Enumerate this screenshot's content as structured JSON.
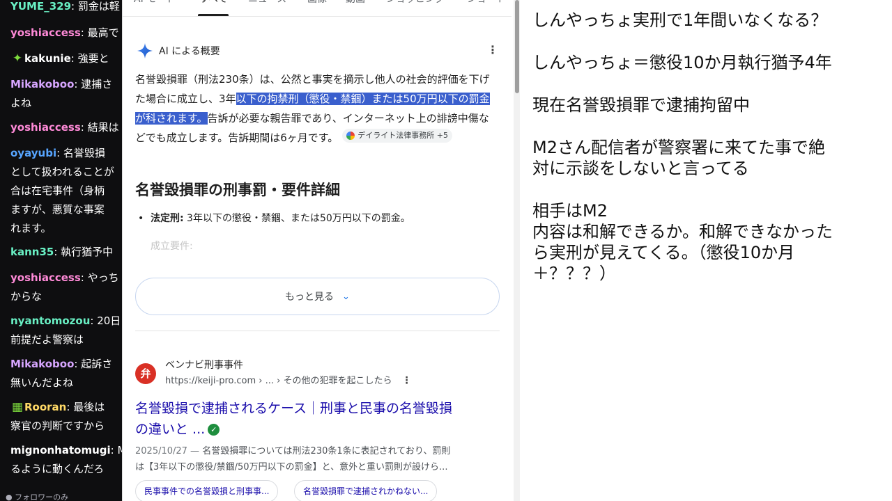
{
  "chat": {
    "messages": [
      {
        "user": "YUME_329",
        "color": "#69f0c4",
        "badge": "",
        "lines": [
          "罰金は軽"
        ]
      },
      {
        "user": "yoshiaccess",
        "color": "#ff8ad8",
        "badge": "",
        "lines": [
          "最高で"
        ]
      },
      {
        "user": "kakunie",
        "color": "#ffffff",
        "badge": "✦",
        "badge_color": "#7ddb3d",
        "lines": [
          "強要と"
        ]
      },
      {
        "user": "Mikakoboo",
        "color": "#d7a6ff",
        "badge": "",
        "lines": [
          "逮捕さ",
          "よね"
        ]
      },
      {
        "user": "yoshiaccess",
        "color": "#ff8ad8",
        "badge": "",
        "lines": [
          "結果は"
        ]
      },
      {
        "user": "oyayubi",
        "color": "#57a5ff",
        "badge": "",
        "lines": [
          "名誉毀損",
          "として扱われることが",
          "合は在宅事件（身柄",
          "ますが、悪質な事案",
          "れます。"
        ]
      },
      {
        "user": "kann35",
        "color": "#69f0c4",
        "badge": "",
        "lines": [
          "執行猶予中"
        ]
      },
      {
        "user": "yoshiaccess",
        "color": "#ff8ad8",
        "badge": "",
        "lines": [
          "やっち",
          "からな"
        ]
      },
      {
        "user": "nyantomozou",
        "color": "#69f0c4",
        "badge": "",
        "lines": [
          "20日",
          "前提だよ警察は"
        ]
      },
      {
        "user": "Mikakoboo",
        "color": "#d7a6ff",
        "badge": "",
        "lines": [
          "起訴さ",
          "無いんだよね"
        ]
      },
      {
        "user": "Rooran",
        "color": "#ffd966",
        "badge": "▦",
        "badge_color": "#7ddb3d",
        "lines": [
          "最後は",
          "察官の判断ですから"
        ]
      },
      {
        "user": "mignonhatomugi",
        "color": "#ffffff",
        "badge": "",
        "lines": [
          "M",
          "るように動くんだろ"
        ]
      }
    ],
    "footer": "● フォロワーのみ"
  },
  "search": {
    "tabs": [
      "AI モード",
      "すべて",
      "ニュース",
      "画像",
      "動画",
      "ショッピング",
      "ショート"
    ],
    "active_tab": "すべて",
    "ai_title": "AI による概要",
    "summary_part1": "名誉毀損罪（刑法230条）は、公然と事実を摘示し他人の社会的評価を下げた場合に成立し、3年",
    "summary_highlight": "以下の拘禁刑（懲役・禁錮）または50万円以下の罰金が科されます。",
    "summary_part2": "告訴が必要な親告罪であり、インターネット上の誹謗中傷などでも成立します。告訴期間は6ヶ月です。",
    "source_chip": "デイライト法律事務所 +5",
    "section_heading": "名誉毀損罪の刑事罰・要件詳細",
    "bullet_label": "法定刑:",
    "bullet_text": " 3年以下の懲役・禁錮、または50万円以下の罰金。",
    "faded_item": "成立要件:",
    "more_button": "もっと見る",
    "result": {
      "favicon_letter": "弁",
      "site_name": "ベンナビ刑事事件",
      "url": "https://keiji-pro.com › ... › その他の犯罪を起こしたら",
      "title_line1": "名誉毀損で逮捕されるケース｜刑事と民事の名誉毀損",
      "title_line2": "の違いと ...",
      "snippet_date": "2025/10/27 — ",
      "snippet_line1": "名誉毀損罪については刑法230条1条に表記されており、罰則",
      "snippet_line2": "は【3年以下の懲役/禁錮/50万円以下の罰金】と、意外と重い罰則が設けら..."
    },
    "related": [
      "民事事件での名誉毀損と刑事事...",
      "名誉毀損罪で逮捕されかねない..."
    ]
  },
  "notes": [
    "しんやっちょ実刑で1年間いなくなる？",
    "しんやっちょ＝懲役10か月執行猶予4年",
    "現在名誉毀損罪で逮捕拘留中",
    "M2さん配信者が警察署に来てた事で絶",
    "対に示談をしないと言ってる",
    "相手はM2",
    "内容は和解できるか。和解できなかった",
    "ら実刑が見えてくる。（懲役10か月",
    "＋？？？）"
  ],
  "colors": {
    "highlight": "#3a5fcd",
    "link": "#1a0dab",
    "chat_bg": "#0e0e10",
    "accent_blue": "#1a73e8"
  }
}
